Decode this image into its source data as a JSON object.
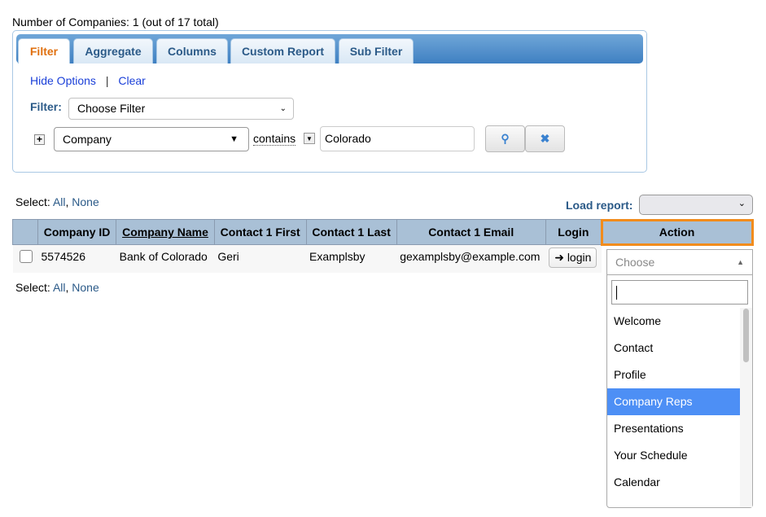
{
  "summary": "Number of Companies: 1 (out of 17 total)",
  "tabs": [
    "Filter",
    "Aggregate",
    "Columns",
    "Custom Report",
    "Sub Filter"
  ],
  "hide_options": "Hide Options",
  "separator": "|",
  "clear": "Clear",
  "filter_label": "Filter:",
  "filter_select": "Choose Filter",
  "field_select": "Company",
  "operator": "contains",
  "value": "Colorado",
  "select_label": "Select:",
  "all": "All",
  "comma": ",",
  "none": "None",
  "load_report": "Load report:",
  "columns": [
    "Company ID",
    "Company Name",
    "Contact 1 First",
    "Contact 1 Last",
    "Contact 1 Email",
    "Login",
    "Action"
  ],
  "row": {
    "id": "5574526",
    "name": "Bank of Colorado",
    "first": "Geri",
    "last": "Examplsby",
    "email": "gexamplsby@example.com",
    "login": "login",
    "action": "Choose"
  },
  "options": [
    "Welcome",
    "Contact",
    "Profile",
    "Company Reps",
    "Presentations",
    "Your Schedule",
    "Calendar"
  ],
  "highlight_color": "#4d8ff5",
  "focus_color": "#f28c1c"
}
